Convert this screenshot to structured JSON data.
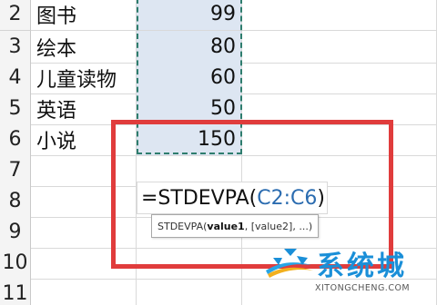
{
  "rows": [
    {
      "num": "2",
      "name": "图书",
      "value": "99"
    },
    {
      "num": "3",
      "name": "绘本",
      "value": "80"
    },
    {
      "num": "4",
      "name": "儿童读物",
      "value": "60"
    },
    {
      "num": "5",
      "name": "英语",
      "value": "50"
    },
    {
      "num": "6",
      "name": "小说",
      "value": "150"
    },
    {
      "num": "7",
      "name": "",
      "value": ""
    },
    {
      "num": "8",
      "name": "",
      "value": ""
    },
    {
      "num": "9",
      "name": "",
      "value": ""
    },
    {
      "num": "10",
      "name": "",
      "value": ""
    },
    {
      "num": "11",
      "name": "",
      "value": ""
    }
  ],
  "formula": {
    "prefix": "=STDEVPA(",
    "range": "C2:C6",
    "suffix": ")"
  },
  "tooltip": {
    "func": "STDEVPA(",
    "arg1": "value1",
    "rest": ", [value2], ...)"
  },
  "watermark": {
    "brand": "系统城",
    "url": "XITONGCHENG.COM"
  },
  "colors": {
    "selection_fill": "#dde6f2",
    "marching_border": "#2e7d6e",
    "highlight_box": "#e03c3c",
    "brand_blue": "#1a8fd8"
  }
}
